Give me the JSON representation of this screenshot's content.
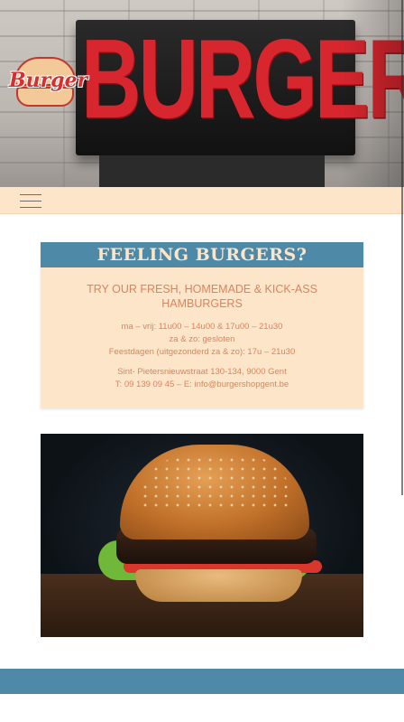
{
  "hero": {
    "sign_text": "BURGERS",
    "logo_text": "Burger"
  },
  "nav": {
    "menu_icon": "hamburger-menu-icon"
  },
  "card": {
    "title": "FEELING BURGERS?",
    "tagline": "TRY OUR FRESH, HOMEMADE & KICK-ASS HAMBURGERS",
    "hours": [
      "ma – vrij: 11u00 – 14u00 & 17u00 – 21u30",
      "za & zo: gesloten",
      "Feestdagen (uitgezonderd za & zo): 17u – 21u30"
    ],
    "address": [
      "Sint- Pietersnieuwstraat 130-134, 9000 Gent",
      "T: 09 139 09 45 – E: info@burgershopgent.be"
    ]
  },
  "colors": {
    "accent_blue": "#4e8aa8",
    "cream": "#fde5ca",
    "text_orange": "#d9845d",
    "sign_red": "#d8262e"
  }
}
